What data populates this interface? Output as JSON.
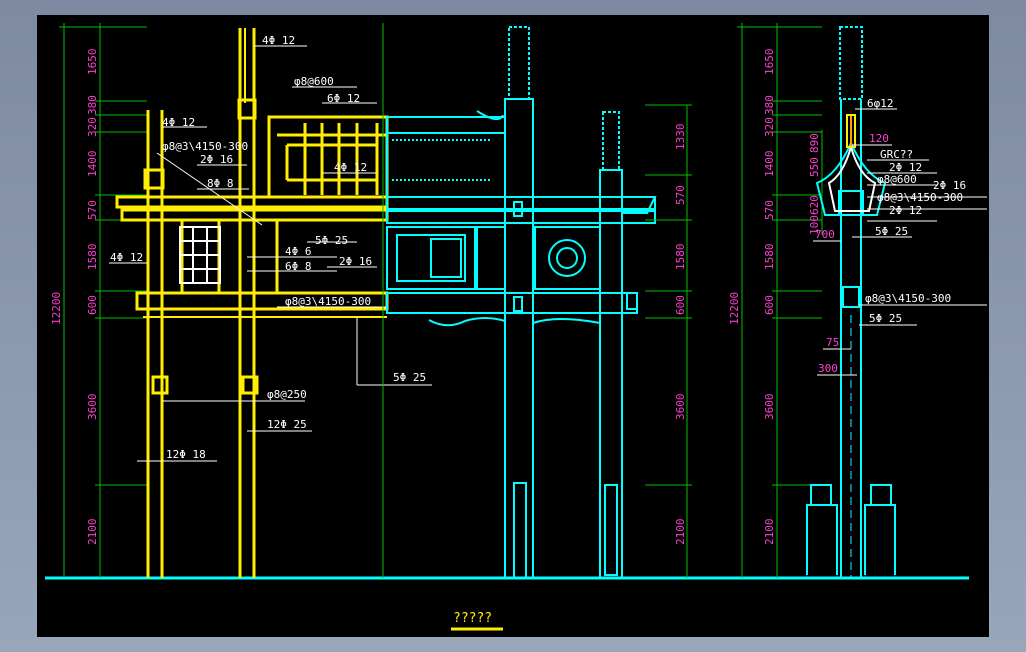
{
  "title": "?????",
  "left_dims": [
    "1650",
    "320",
    "380",
    "1400",
    "570",
    "1580",
    "600",
    "3600",
    "2100"
  ],
  "left_total": "12200",
  "mid_dims": [
    "1330",
    "570",
    "1580",
    "600",
    "3600",
    "2100"
  ],
  "right_dims": [
    "1650",
    "320",
    "380",
    "1400",
    "570",
    "1580",
    "600",
    "3600",
    "2100"
  ],
  "right_total": "12200",
  "right_small_dims": [
    "550",
    "890",
    "100",
    "620"
  ],
  "left_labels": [
    "4Φ 12",
    "4Φ 12",
    "φ8@600",
    "6Φ 12",
    "φ8@3\\4150-300",
    "2Φ 16",
    "8Φ 8",
    "4Φ 12",
    "4Φ 12",
    "4Φ 6",
    "6Φ 8",
    "2Φ 16",
    "5Φ 25",
    "φ8@3\\4150-300",
    "5Φ 25",
    "φ8@250",
    "12Φ 25",
    "12Φ 18"
  ],
  "right_labels": [
    "6φ12",
    "120",
    "GRC??",
    "2Φ 12",
    "φ8@600",
    "2Φ 16",
    "φ8@3\\4150-300",
    "2Φ 12",
    "5Φ 25",
    "700",
    "φ8@3\\4150-300",
    "5Φ 25",
    "75",
    "300"
  ],
  "colors": {
    "magenta": "#ff3fd0",
    "yellow": "#ffee00",
    "cyan": "#00ffff",
    "white": "#ffffff",
    "green": "#00c000"
  }
}
